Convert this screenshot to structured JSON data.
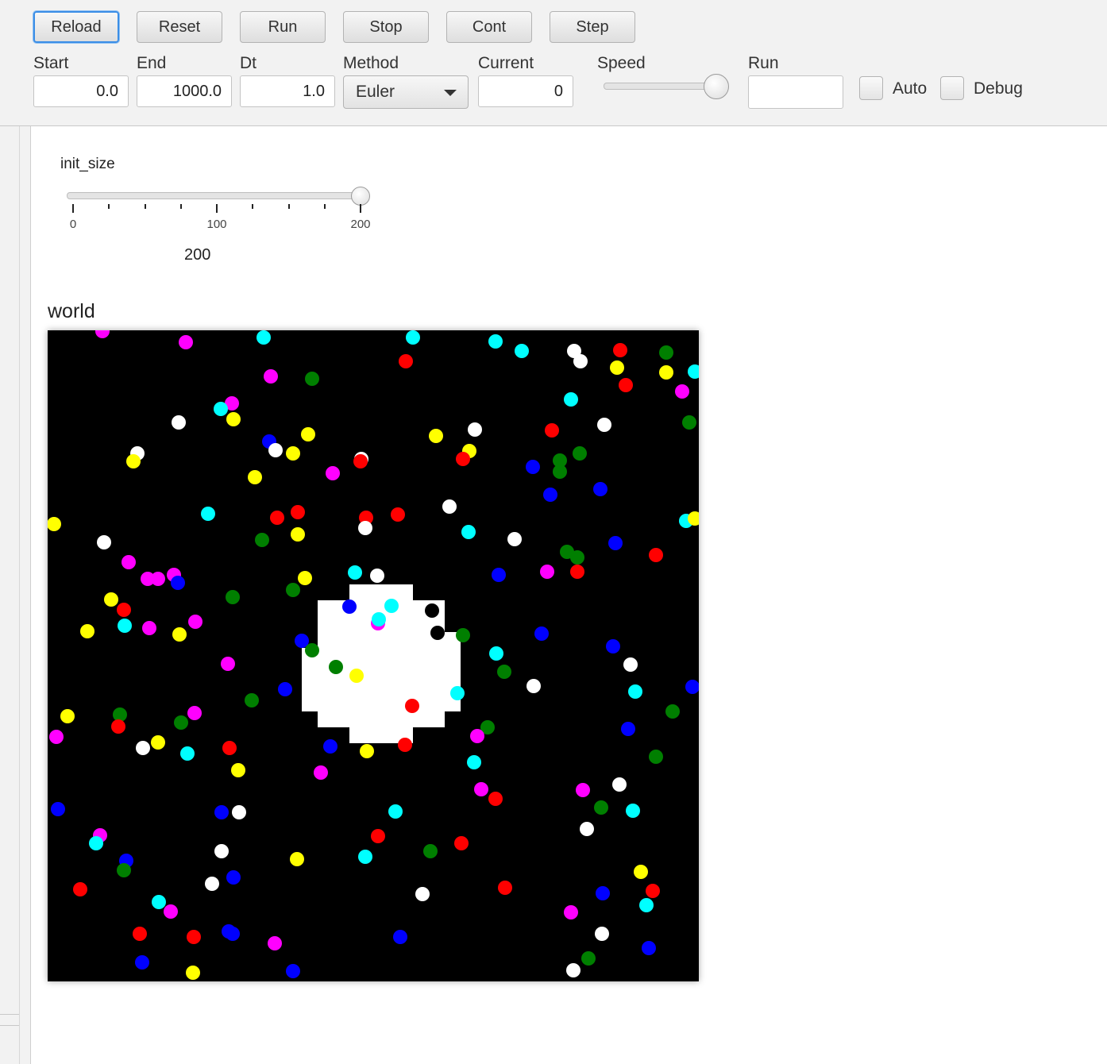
{
  "toolbar": {
    "buttons": [
      "Reload",
      "Reset",
      "Run",
      "Stop",
      "Cont",
      "Step"
    ],
    "start_label": "Start",
    "start_value": "0.0",
    "end_label": "End",
    "end_value": "1000.0",
    "dt_label": "Dt",
    "dt_value": "1.0",
    "method_label": "Method",
    "method_value": "Euler",
    "current_label": "Current",
    "current_value": "0",
    "speed_label": "Speed",
    "speed_level": 1.0,
    "run_label": "Run",
    "run_value": "",
    "auto_label": "Auto",
    "auto_checked": false,
    "debug_label": "Debug",
    "debug_checked": false
  },
  "param": {
    "name": "init_size",
    "min": 0,
    "max": 200,
    "value": 200,
    "value_text": "200",
    "tick_labels": [
      "0",
      "100",
      "200"
    ]
  },
  "world": {
    "title": "world",
    "background": "#000000",
    "colors": {
      "w": "#ffffff",
      "r": "#ff0000",
      "g": "#007f00",
      "b": "#0000ff",
      "y": "#ffff00",
      "c": "#00ffff",
      "m": "#ff00ff",
      "k": "#000000"
    },
    "dots": [
      [
        "m",
        69,
        1
      ],
      [
        "m",
        174,
        15
      ],
      [
        "c",
        272,
        9
      ],
      [
        "c",
        460,
        9
      ],
      [
        "c",
        564,
        14
      ],
      [
        "c",
        597,
        26
      ],
      [
        "w",
        663,
        26
      ],
      [
        "w",
        671,
        39
      ],
      [
        "r",
        721,
        25
      ],
      [
        "g",
        779,
        28
      ],
      [
        "y",
        717,
        47
      ],
      [
        "y",
        779,
        53
      ],
      [
        "r",
        728,
        69
      ],
      [
        "m",
        799,
        77
      ],
      [
        "c",
        815,
        52
      ],
      [
        "c",
        659,
        87
      ],
      [
        "r",
        451,
        39
      ],
      [
        "m",
        281,
        58
      ],
      [
        "g",
        333,
        61
      ],
      [
        "m",
        232,
        92
      ],
      [
        "c",
        218,
        99
      ],
      [
        "y",
        234,
        112
      ],
      [
        "w",
        165,
        116
      ],
      [
        "g",
        808,
        116
      ],
      [
        "w",
        701,
        119
      ],
      [
        "y",
        328,
        131
      ],
      [
        "y",
        489,
        133
      ],
      [
        "w",
        538,
        125
      ],
      [
        "r",
        635,
        126
      ],
      [
        "b",
        279,
        140
      ],
      [
        "w",
        287,
        151
      ],
      [
        "y",
        309,
        155
      ],
      [
        "w",
        113,
        155
      ],
      [
        "y",
        108,
        165
      ],
      [
        "y",
        531,
        152
      ],
      [
        "r",
        523,
        162
      ],
      [
        "w",
        395,
        162
      ],
      [
        "r",
        394,
        165
      ],
      [
        "g",
        645,
        164
      ],
      [
        "g",
        670,
        155
      ],
      [
        "g",
        645,
        178
      ],
      [
        "b",
        611,
        172
      ],
      [
        "m",
        359,
        180
      ],
      [
        "y",
        261,
        185
      ],
      [
        "b",
        696,
        200
      ],
      [
        "b",
        633,
        207
      ],
      [
        "w",
        506,
        222
      ],
      [
        "r",
        315,
        229
      ],
      [
        "r",
        289,
        236
      ],
      [
        "r",
        401,
        236
      ],
      [
        "r",
        441,
        232
      ],
      [
        "c",
        202,
        231
      ],
      [
        "y",
        315,
        257
      ],
      [
        "w",
        400,
        249
      ],
      [
        "w",
        588,
        263
      ],
      [
        "c",
        530,
        254
      ],
      [
        "c",
        804,
        240
      ],
      [
        "y",
        815,
        237
      ],
      [
        "y",
        8,
        244
      ],
      [
        "w",
        71,
        267
      ],
      [
        "g",
        270,
        264
      ],
      [
        "r",
        766,
        283
      ],
      [
        "b",
        715,
        268
      ],
      [
        "g",
        654,
        279
      ],
      [
        "g",
        667,
        286
      ],
      [
        "r",
        667,
        304
      ],
      [
        "m",
        629,
        304
      ],
      [
        "b",
        568,
        308
      ],
      [
        "m",
        102,
        292
      ],
      [
        "m",
        126,
        313
      ],
      [
        "m",
        139,
        313
      ],
      [
        "m",
        159,
        308
      ],
      [
        "b",
        164,
        318
      ],
      [
        "c",
        387,
        305
      ],
      [
        "w",
        415,
        309
      ],
      [
        "y",
        324,
        312
      ],
      [
        "g",
        309,
        327
      ],
      [
        "g",
        233,
        336
      ],
      [
        "y",
        80,
        339
      ],
      [
        "r",
        96,
        352
      ],
      [
        "c",
        97,
        372
      ],
      [
        "m",
        128,
        375
      ],
      [
        "y",
        166,
        383
      ],
      [
        "m",
        186,
        367
      ],
      [
        "y",
        50,
        379
      ],
      [
        "b",
        380,
        348
      ],
      [
        "c",
        433,
        347
      ],
      [
        "m",
        416,
        369
      ],
      [
        "c",
        417,
        364
      ],
      [
        "k",
        484,
        353
      ],
      [
        "k",
        491,
        381
      ],
      [
        "g",
        523,
        384
      ],
      [
        "b",
        320,
        391
      ],
      [
        "g",
        333,
        403
      ],
      [
        "g",
        363,
        424
      ],
      [
        "y",
        389,
        435
      ],
      [
        "b",
        622,
        382
      ],
      [
        "c",
        565,
        407
      ],
      [
        "g",
        575,
        430
      ],
      [
        "w",
        612,
        448
      ],
      [
        "b",
        712,
        398
      ],
      [
        "w",
        734,
        421
      ],
      [
        "c",
        740,
        455
      ],
      [
        "b",
        812,
        449
      ],
      [
        "m",
        227,
        420
      ],
      [
        "b",
        299,
        452
      ],
      [
        "g",
        257,
        466
      ],
      [
        "c",
        516,
        457
      ],
      [
        "r",
        459,
        473
      ],
      [
        "g",
        787,
        480
      ],
      [
        "g",
        91,
        484
      ],
      [
        "r",
        89,
        499
      ],
      [
        "y",
        25,
        486
      ],
      [
        "m",
        11,
        512
      ],
      [
        "m",
        185,
        482
      ],
      [
        "g",
        168,
        494
      ],
      [
        "y",
        139,
        519
      ],
      [
        "w",
        120,
        526
      ],
      [
        "c",
        176,
        533
      ],
      [
        "r",
        229,
        526
      ],
      [
        "b",
        356,
        524
      ],
      [
        "y",
        402,
        530
      ],
      [
        "r",
        450,
        522
      ],
      [
        "g",
        554,
        500
      ],
      [
        "m",
        541,
        511
      ],
      [
        "b",
        731,
        502
      ],
      [
        "c",
        537,
        544
      ],
      [
        "y",
        240,
        554
      ],
      [
        "m",
        344,
        557
      ],
      [
        "g",
        766,
        537
      ],
      [
        "m",
        546,
        578
      ],
      [
        "r",
        564,
        590
      ],
      [
        "m",
        674,
        579
      ],
      [
        "w",
        720,
        572
      ],
      [
        "c",
        737,
        605
      ],
      [
        "g",
        697,
        601
      ],
      [
        "w",
        679,
        628
      ],
      [
        "b",
        13,
        603
      ],
      [
        "b",
        219,
        607
      ],
      [
        "w",
        241,
        607
      ],
      [
        "c",
        438,
        606
      ],
      [
        "m",
        66,
        636
      ],
      [
        "c",
        61,
        646
      ],
      [
        "r",
        416,
        637
      ],
      [
        "r",
        521,
        646
      ],
      [
        "g",
        482,
        656
      ],
      [
        "b",
        99,
        668
      ],
      [
        "g",
        96,
        680
      ],
      [
        "w",
        219,
        656
      ],
      [
        "y",
        314,
        666
      ],
      [
        "c",
        400,
        663
      ],
      [
        "c",
        140,
        720
      ],
      [
        "m",
        155,
        732
      ],
      [
        "r",
        41,
        704
      ],
      [
        "w",
        207,
        697
      ],
      [
        "b",
        234,
        689
      ],
      [
        "r",
        576,
        702
      ],
      [
        "w",
        472,
        710
      ],
      [
        "y",
        747,
        682
      ],
      [
        "r",
        762,
        706
      ],
      [
        "b",
        699,
        709
      ],
      [
        "c",
        754,
        724
      ],
      [
        "m",
        659,
        733
      ],
      [
        "r",
        116,
        760
      ],
      [
        "r",
        184,
        764
      ],
      [
        "b",
        228,
        757
      ],
      [
        "b",
        233,
        760
      ],
      [
        "m",
        286,
        772
      ],
      [
        "b",
        444,
        764
      ],
      [
        "w",
        698,
        760
      ],
      [
        "b",
        757,
        778
      ],
      [
        "g",
        681,
        791
      ],
      [
        "b",
        119,
        796
      ],
      [
        "y",
        183,
        809
      ],
      [
        "b",
        309,
        807
      ],
      [
        "w",
        662,
        806
      ]
    ]
  }
}
